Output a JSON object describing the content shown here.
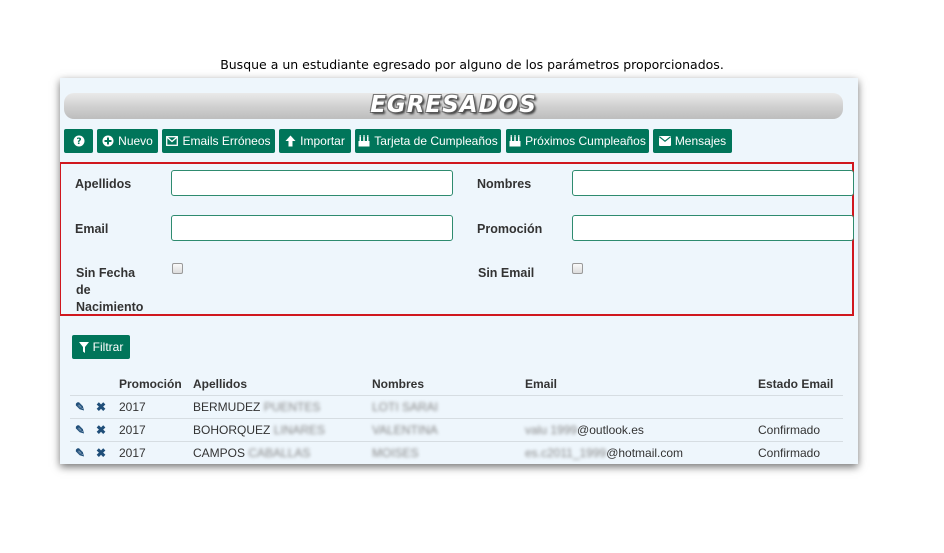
{
  "caption": "Busque a un estudiante egresado por alguno de los parámetros proporcionados.",
  "banner": {
    "title": "EGRESADOS"
  },
  "toolbar": {
    "help_label": "",
    "nuevo_label": "Nuevo",
    "emails_label": "Emails Erróneos",
    "importar_label": "Importar",
    "tarjeta_label": "Tarjeta de Cumpleaños",
    "proximos_label": "Próximos Cumpleaños",
    "mensajes_label": "Mensajes"
  },
  "form": {
    "apellidos_label": "Apellidos",
    "apellidos_value": "",
    "nombres_label": "Nombres",
    "nombres_value": "",
    "email_label": "Email",
    "email_value": "",
    "promocion_label": "Promoción",
    "promocion_value": "",
    "sin_fecha_label_1": "Sin Fecha",
    "sin_fecha_label_2": "de",
    "sin_fecha_label_3": "Nacimiento",
    "sin_fecha_checked": false,
    "sin_email_label": "Sin Email",
    "sin_email_checked": false
  },
  "filter_button": {
    "label": "Filtrar"
  },
  "table": {
    "headers": {
      "promocion": "Promoción",
      "apellidos": "Apellidos",
      "nombres": "Nombres",
      "email": "Email",
      "estado": "Estado Email"
    },
    "rows": [
      {
        "promocion": "2017",
        "apellido1": "BERMUDEZ",
        "apellido2": "PUENTES",
        "nombres": "LOTI SARAI",
        "email_user": "",
        "email_domain": "",
        "estado": ""
      },
      {
        "promocion": "2017",
        "apellido1": "BOHORQUEZ",
        "apellido2": "LINARES",
        "nombres": "VALENTINA",
        "email_user": "valu 1999",
        "email_domain": "@outlook.es",
        "estado": "Confirmado"
      },
      {
        "promocion": "2017",
        "apellido1": "CAMPOS",
        "apellido2": "CABALLAS",
        "nombres": "MOISES",
        "email_user": "es.c2011_1999",
        "email_domain": "@hotmail.com",
        "estado": "Confirmado"
      }
    ]
  },
  "colors": {
    "accent": "#00755a",
    "highlight_border": "#d0171e",
    "panel_bg": "#eef6fc"
  }
}
